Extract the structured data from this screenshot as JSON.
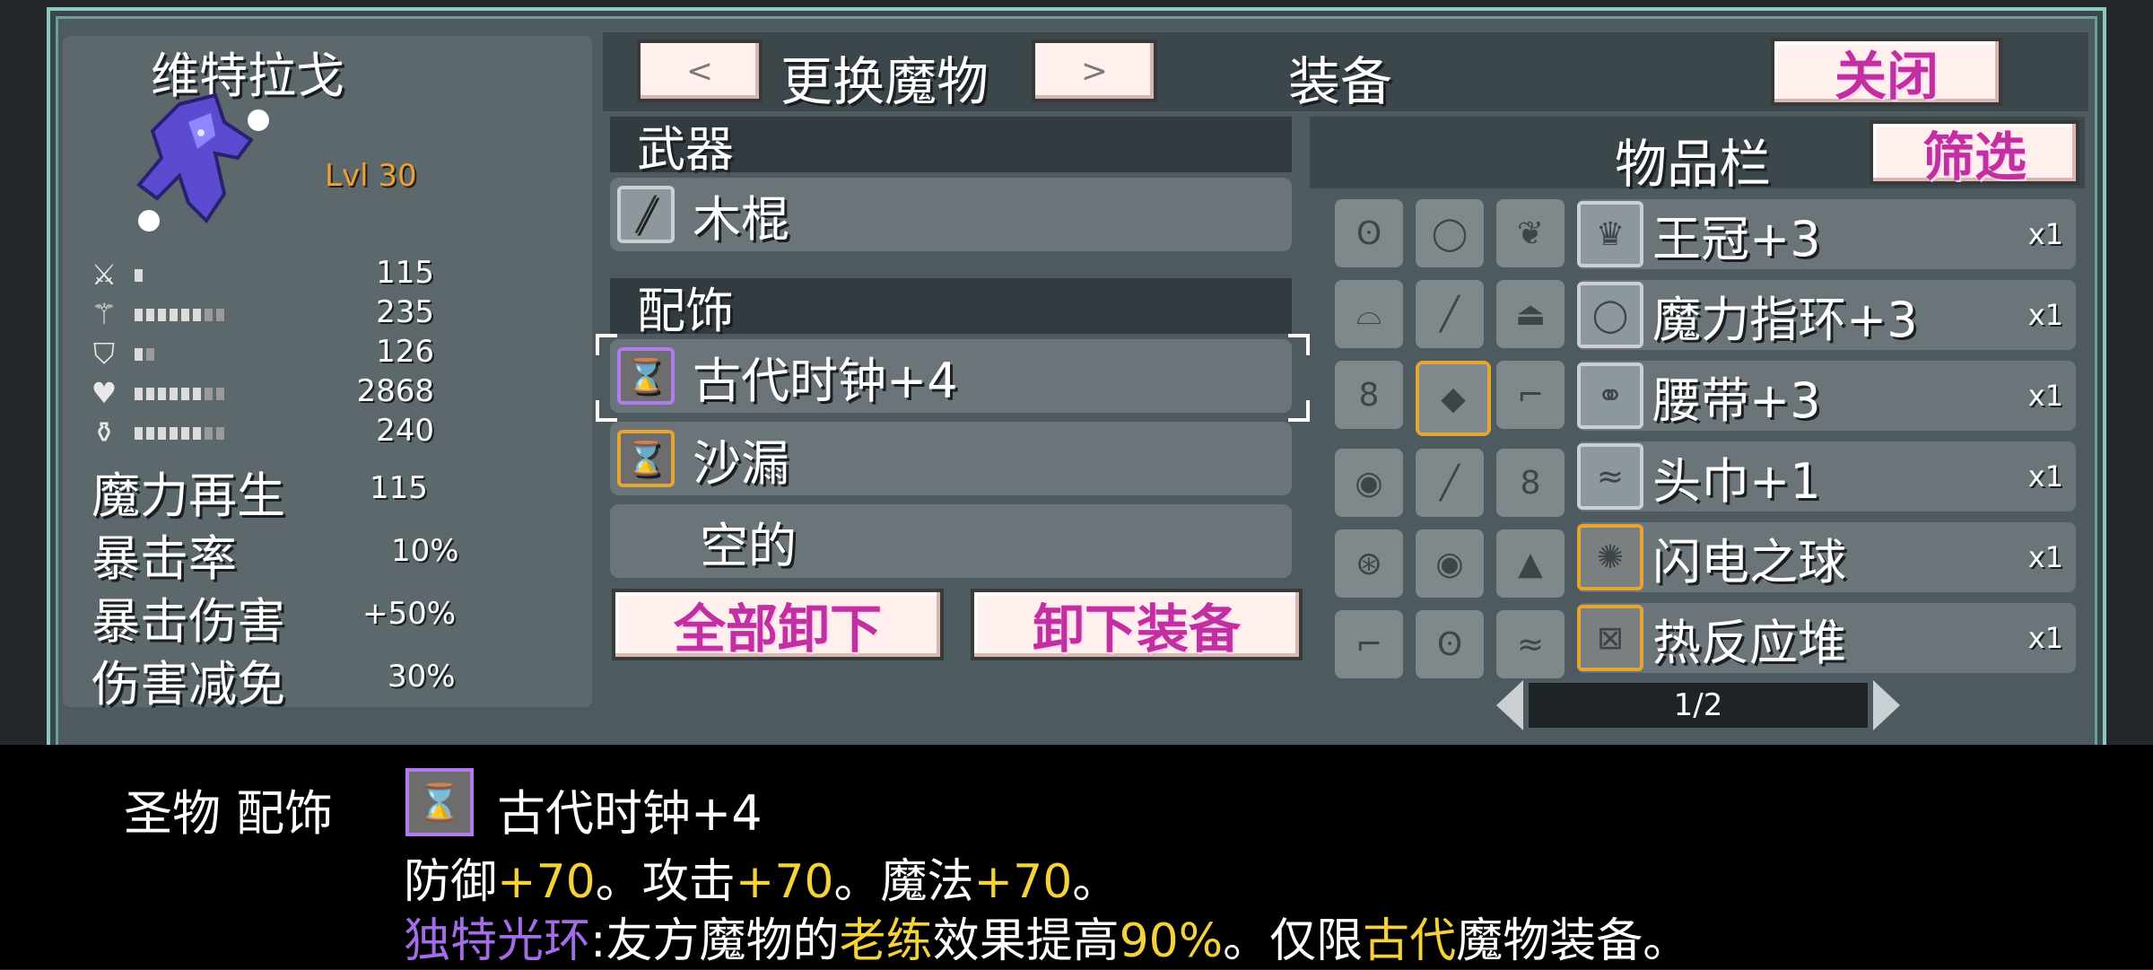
{
  "monster": {
    "name": "维特拉戈",
    "level": "Lvl 30",
    "stats": [
      {
        "icon": "sword-icon",
        "value": "115",
        "pips": 1
      },
      {
        "icon": "staff-icon",
        "value": "235",
        "pips": 8
      },
      {
        "icon": "shield-icon",
        "value": "126",
        "pips": 2
      },
      {
        "icon": "heart-icon",
        "value": "2868",
        "pips": 8
      },
      {
        "icon": "potion-icon",
        "value": "240",
        "pips": 8
      }
    ],
    "extra_stats": [
      {
        "label": "魔力再生",
        "value": "115"
      },
      {
        "label": "暴击率",
        "value": "10%"
      },
      {
        "label": "暴击伤害",
        "value": "+50%"
      },
      {
        "label": "伤害减免",
        "value": "30%"
      }
    ]
  },
  "header": {
    "prev_label": "<",
    "change_monster": "更换魔物",
    "next_label": ">",
    "title": "装备",
    "close_label": "关闭"
  },
  "weapon": {
    "heading": "武器",
    "item": "木棍",
    "icon": "stick-icon"
  },
  "accessory": {
    "heading": "配饰",
    "slots": [
      {
        "name": "古代时钟+4",
        "icon": "hourglass-icon",
        "frame": "purple",
        "selected": true
      },
      {
        "name": "沙漏",
        "icon": "hourglass-icon",
        "frame": "gold",
        "selected": false
      },
      {
        "name": "空的",
        "icon": "",
        "frame": "none",
        "selected": false
      }
    ]
  },
  "actions": {
    "unequip_all": "全部卸下",
    "unequip": "卸下装备"
  },
  "inventory": {
    "heading": "物品栏",
    "filter_label": "筛选",
    "grid": [
      [
        "gloves-icon",
        "ring-icon",
        "feather-icon"
      ],
      [
        "helmet-icon",
        "staff-icon",
        "hat-icon"
      ],
      [
        "bell-icon",
        "gem-icon",
        "boot-icon"
      ],
      [
        "amulet-icon",
        "staff-icon",
        "bell-icon"
      ],
      [
        "shield-icon",
        "amulet-icon",
        "wizard-hat-icon"
      ],
      [
        "boot-icon",
        "gloves-icon",
        "scarf-icon"
      ]
    ],
    "items": [
      {
        "name": "王冠+3",
        "qty": "x1",
        "icon": "crown-icon",
        "frame": "plain"
      },
      {
        "name": "魔力指环+3",
        "qty": "x1",
        "icon": "ring-icon",
        "frame": "plain"
      },
      {
        "name": "腰带+3",
        "qty": "x1",
        "icon": "belt-icon",
        "frame": "plain"
      },
      {
        "name": "头巾+1",
        "qty": "x1",
        "icon": "scarf-icon",
        "frame": "plain"
      },
      {
        "name": "闪电之球",
        "qty": "x1",
        "icon": "lightning-orb-icon",
        "frame": "gold"
      },
      {
        "name": "热反应堆",
        "qty": "x1",
        "icon": "reactor-icon",
        "frame": "gold"
      }
    ],
    "page": "1/2"
  },
  "tooltip": {
    "category": "圣物 配饰",
    "item_name": "古代时钟+4",
    "line2": [
      {
        "t": "防御",
        "c": "w"
      },
      {
        "t": "+70",
        "c": "y"
      },
      {
        "t": "。攻击",
        "c": "w"
      },
      {
        "t": "+70",
        "c": "y"
      },
      {
        "t": "。魔法",
        "c": "w"
      },
      {
        "t": "+70",
        "c": "y"
      },
      {
        "t": "。",
        "c": "w"
      }
    ],
    "line3": [
      {
        "t": "独特光环",
        "c": "p"
      },
      {
        "t": ":友方魔物的",
        "c": "w"
      },
      {
        "t": "老练",
        "c": "y"
      },
      {
        "t": "效果提高",
        "c": "w"
      },
      {
        "t": "90%",
        "c": "y"
      },
      {
        "t": "。仅限",
        "c": "w"
      },
      {
        "t": "古代",
        "c": "y"
      },
      {
        "t": "魔物装备。",
        "c": "w"
      }
    ]
  },
  "colors": {
    "accent_pink": "#c12fa1",
    "gold_frame": "#e6a431",
    "purple_frame": "#b27bf0",
    "highlight_yellow": "#f5d13a",
    "aura_purple": "#a56ce8"
  }
}
